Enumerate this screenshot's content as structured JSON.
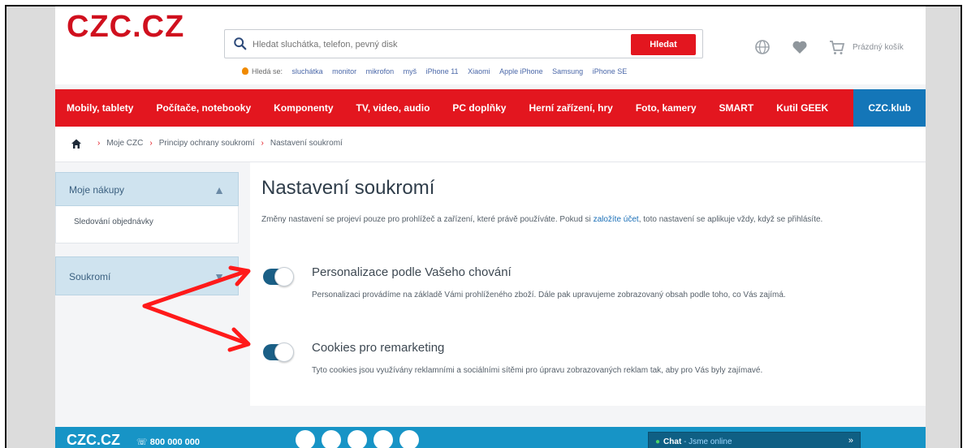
{
  "brand": {
    "logo": "CZC.CZ",
    "accent_color": "#e3161f",
    "club_color": "#1476b8"
  },
  "search": {
    "placeholder": "Hledat sluchátka, telefon, pevný disk",
    "button_label": "Hledat",
    "hints_lead": "Hledá se:",
    "hints": [
      "sluchátka",
      "monitor",
      "mikrofon",
      "myš",
      "iPhone 11",
      "Xiaomi",
      "Apple iPhone",
      "Samsung",
      "iPhone SE"
    ]
  },
  "header": {
    "cart_label": "Prázdný košík",
    "icons": [
      "globe-icon",
      "heart-icon",
      "cart-icon"
    ]
  },
  "nav": {
    "items": [
      "Mobily, tablety",
      "Počítače, notebooky",
      "Komponenty",
      "TV, video, audio",
      "PC doplňky",
      "Herní zařízení, hry",
      "Foto, kamery",
      "SMART",
      "Kutil GEEK"
    ],
    "club": "CZC.klub"
  },
  "breadcrumb": {
    "items": [
      "Moje CZC",
      "Principy ochrany soukromí",
      "Nastavení soukromí"
    ]
  },
  "sidebar": {
    "sections": [
      {
        "label": "Moje nákupy",
        "chevron": "▲",
        "sub": "Sledování objednávky"
      },
      {
        "label": "Soukromí",
        "chevron": "▼"
      }
    ]
  },
  "main": {
    "title": "Nastavení soukromí",
    "intro_before": "Změny nastavení se projeví pouze pro prohlížeč a zařízení, které právě používáte. Pokud si ",
    "intro_link": "založíte účet",
    "intro_after": ", toto nastavení se aplikuje vždy, když se přihlásíte.",
    "options": [
      {
        "title": "Personalizace podle Vašeho chování",
        "description": "Personalizaci provádíme na základě Vámi prohlíženého zboží. Dále pak upravujeme zobrazovaný obsah podle toho, co Vás zajímá.",
        "enabled": true
      },
      {
        "title": "Cookies pro remarketing",
        "description": "Tyto cookies jsou využívány reklamními a sociálními sítěmi pro úpravu zobrazovaných reklam tak, aby pro Vás byly zajímavé.",
        "enabled": true
      }
    ]
  },
  "footer": {
    "logo": "CZC.CZ",
    "phone": "☏ 800 000 000",
    "chat_label": "Chat",
    "chat_status": "- Jsme online",
    "chat_close": "»"
  },
  "annotation": {
    "arrow_color": "#ff1a1a"
  }
}
